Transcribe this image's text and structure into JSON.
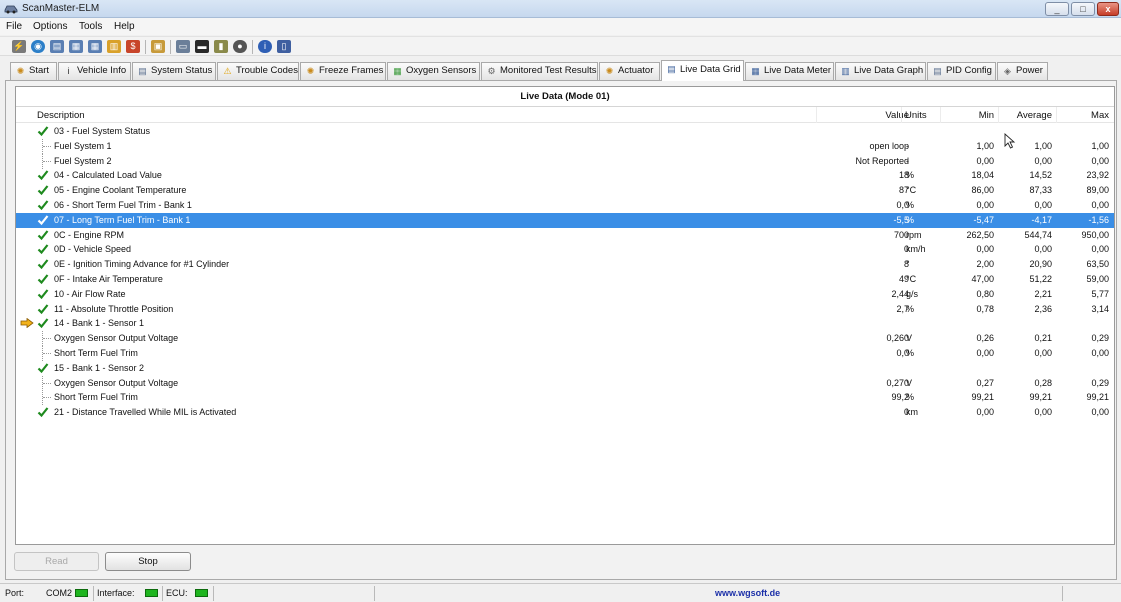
{
  "window": {
    "title": "ScanMaster-ELM",
    "min": "_",
    "max": "□",
    "close": "x"
  },
  "menu": [
    "File",
    "Options",
    "Tools",
    "Help"
  ],
  "tabs": [
    "Start",
    "Vehicle Info",
    "System Status",
    "Trouble Codes",
    "Freeze Frames",
    "Oxygen Sensors",
    "Monitored Test Results",
    "Actuator",
    "Live Data Grid",
    "Live Data Meter",
    "Live Data Graph",
    "PID Config",
    "Power"
  ],
  "active_tab": "Live Data Grid",
  "grid": {
    "title": "Live Data (Mode 01)",
    "columns": {
      "desc": "Description",
      "value": "Value",
      "units": "Units",
      "min": "Min",
      "avg": "Average",
      "max": "Max"
    },
    "rows": [
      {
        "desc": "03 - Fuel System Status",
        "value": "",
        "units": "",
        "min": "",
        "avg": "",
        "max": "",
        "check": true,
        "child": false
      },
      {
        "desc": "Fuel System 1",
        "value": "open loop",
        "units": "-",
        "min": "1,00",
        "avg": "1,00",
        "max": "1,00",
        "check": false,
        "child": true
      },
      {
        "desc": "Fuel System 2",
        "value": "Not Reported",
        "units": "-",
        "min": "0,00",
        "avg": "0,00",
        "max": "0,00",
        "check": false,
        "child": true
      },
      {
        "desc": "04 - Calculated Load Value",
        "value": "18",
        "units": "%",
        "min": "18,04",
        "avg": "14,52",
        "max": "23,92",
        "check": true,
        "child": false
      },
      {
        "desc": "05 - Engine Coolant Temperature",
        "value": "87",
        "units": "°C",
        "min": "86,00",
        "avg": "87,33",
        "max": "89,00",
        "check": true,
        "child": false
      },
      {
        "desc": "06 - Short Term Fuel Trim - Bank 1",
        "value": "0,0",
        "units": "%",
        "min": "0,00",
        "avg": "0,00",
        "max": "0,00",
        "check": true,
        "child": false
      },
      {
        "desc": "07 - Long Term Fuel Trim - Bank 1",
        "value": "-5,5",
        "units": "%",
        "min": "-5,47",
        "avg": "-4,17",
        "max": "-1,56",
        "check": true,
        "child": false,
        "selected": true
      },
      {
        "desc": "0C - Engine RPM",
        "value": "700",
        "units": "rpm",
        "min": "262,50",
        "avg": "544,74",
        "max": "950,00",
        "check": true,
        "child": false
      },
      {
        "desc": "0D - Vehicle Speed",
        "value": "0",
        "units": "km/h",
        "min": "0,00",
        "avg": "0,00",
        "max": "0,00",
        "check": true,
        "child": false
      },
      {
        "desc": "0E - Ignition Timing Advance for #1 Cylinder",
        "value": "8",
        "units": "°",
        "min": "2,00",
        "avg": "20,90",
        "max": "63,50",
        "check": true,
        "child": false
      },
      {
        "desc": "0F - Intake Air Temperature",
        "value": "49",
        "units": "°C",
        "min": "47,00",
        "avg": "51,22",
        "max": "59,00",
        "check": true,
        "child": false
      },
      {
        "desc": "10 - Air Flow Rate",
        "value": "2,44",
        "units": "g/s",
        "min": "0,80",
        "avg": "2,21",
        "max": "5,77",
        "check": true,
        "child": false
      },
      {
        "desc": "11 - Absolute Throttle Position",
        "value": "2,7",
        "units": "%",
        "min": "0,78",
        "avg": "2,36",
        "max": "3,14",
        "check": true,
        "child": false
      },
      {
        "desc": "14 - Bank 1 - Sensor 1",
        "value": "",
        "units": "",
        "min": "",
        "avg": "",
        "max": "",
        "check": true,
        "child": false,
        "arrow": true
      },
      {
        "desc": "Oxygen Sensor Output Voltage",
        "value": "0,260",
        "units": "V",
        "min": "0,26",
        "avg": "0,21",
        "max": "0,29",
        "check": false,
        "child": true
      },
      {
        "desc": "Short Term Fuel Trim",
        "value": "0,0",
        "units": "%",
        "min": "0,00",
        "avg": "0,00",
        "max": "0,00",
        "check": false,
        "child": true
      },
      {
        "desc": "15 - Bank 1 - Sensor 2",
        "value": "",
        "units": "",
        "min": "",
        "avg": "",
        "max": "",
        "check": true,
        "child": false
      },
      {
        "desc": "Oxygen Sensor Output Voltage",
        "value": "0,270",
        "units": "V",
        "min": "0,27",
        "avg": "0,28",
        "max": "0,29",
        "check": false,
        "child": true
      },
      {
        "desc": "Short Term Fuel Trim",
        "value": "99,2",
        "units": "%",
        "min": "99,21",
        "avg": "99,21",
        "max": "99,21",
        "check": false,
        "child": true
      },
      {
        "desc": "21 - Distance Travelled While MIL is Activated",
        "value": "0",
        "units": "km",
        "min": "0,00",
        "avg": "0,00",
        "max": "0,00",
        "check": true,
        "child": false
      }
    ]
  },
  "buttons": {
    "read": "Read",
    "stop": "Stop"
  },
  "status": {
    "port_label": "Port:",
    "port_value": "COM2",
    "interface_label": "Interface:",
    "ecu_label": "ECU:",
    "website": "www.wgsoft.de"
  }
}
